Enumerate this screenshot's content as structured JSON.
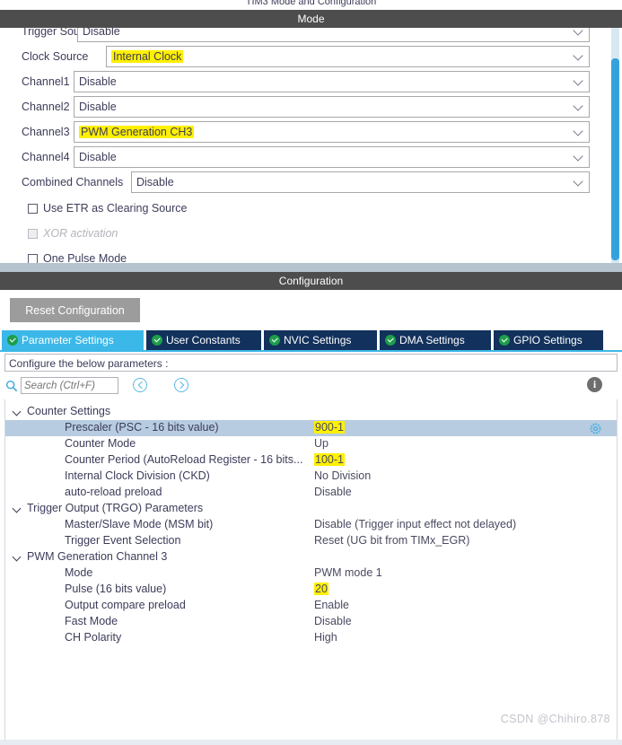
{
  "window": {
    "title": "TIM3 Mode and Configuration"
  },
  "sections": {
    "mode_header": "Mode",
    "configuration_header": "Configuration"
  },
  "mode": {
    "rows": [
      {
        "label": "Trigger Source",
        "value": "Disable",
        "highlighted": false
      },
      {
        "label": "Clock Source",
        "value": "Internal Clock",
        "highlighted": true
      },
      {
        "label": "Channel1",
        "value": "Disable",
        "highlighted": false
      },
      {
        "label": "Channel2",
        "value": "Disable",
        "highlighted": false
      },
      {
        "label": "Channel3",
        "value": "PWM Generation CH3",
        "highlighted": true
      },
      {
        "label": "Channel4",
        "value": "Disable",
        "highlighted": false
      },
      {
        "label": "Combined Channels",
        "value": "Disable",
        "highlighted": false
      }
    ],
    "checkboxes": [
      {
        "label": "Use ETR as Clearing Source",
        "checked": false,
        "disabled": false
      },
      {
        "label": "XOR activation",
        "checked": false,
        "disabled": true
      },
      {
        "label": "One Pulse Mode",
        "checked": false,
        "disabled": false
      }
    ]
  },
  "configuration": {
    "reset_button": "Reset Configuration",
    "tabs": [
      {
        "label": "Parameter Settings",
        "active": true
      },
      {
        "label": "User Constants",
        "active": false
      },
      {
        "label": "NVIC Settings",
        "active": false
      },
      {
        "label": "DMA Settings",
        "active": false
      },
      {
        "label": "GPIO Settings",
        "active": false
      }
    ],
    "hint": "Configure the below parameters :",
    "search_placeholder": "Search (Ctrl+F)",
    "search_value": "",
    "info_glyph": "i",
    "tree": [
      {
        "group": "Counter Settings",
        "expanded": true,
        "params": [
          {
            "name": "Prescaler (PSC - 16 bits value)",
            "value": "900-1",
            "highlighted": true,
            "selected": true,
            "gear": true
          },
          {
            "name": "Counter Mode",
            "value": "Up",
            "highlighted": false,
            "selected": false,
            "gear": false
          },
          {
            "name": "Counter Period (AutoReload Register - 16 bits...",
            "value": "100-1",
            "highlighted": true,
            "selected": false,
            "gear": false
          },
          {
            "name": "Internal Clock Division (CKD)",
            "value": "No Division",
            "highlighted": false,
            "selected": false,
            "gear": false
          },
          {
            "name": "auto-reload preload",
            "value": "Disable",
            "highlighted": false,
            "selected": false,
            "gear": false
          }
        ]
      },
      {
        "group": "Trigger Output (TRGO) Parameters",
        "expanded": true,
        "params": [
          {
            "name": "Master/Slave Mode (MSM bit)",
            "value": "Disable (Trigger input effect not delayed)",
            "highlighted": false,
            "selected": false,
            "gear": false
          },
          {
            "name": "Trigger Event Selection",
            "value": "Reset (UG bit from TIMx_EGR)",
            "highlighted": false,
            "selected": false,
            "gear": false
          }
        ]
      },
      {
        "group": "PWM Generation Channel 3",
        "expanded": true,
        "params": [
          {
            "name": "Mode",
            "value": "PWM mode 1",
            "highlighted": false,
            "selected": false,
            "gear": false
          },
          {
            "name": "Pulse (16 bits value)",
            "value": "20",
            "highlighted": true,
            "selected": false,
            "gear": false
          },
          {
            "name": "Output compare preload",
            "value": "Enable",
            "highlighted": false,
            "selected": false,
            "gear": false
          },
          {
            "name": "Fast Mode",
            "value": "Disable",
            "highlighted": false,
            "selected": false,
            "gear": false
          },
          {
            "name": "CH Polarity",
            "value": "High",
            "highlighted": false,
            "selected": false,
            "gear": false
          }
        ]
      }
    ]
  },
  "watermark": "CSDN @Chihiro.878",
  "colors": {
    "section_header_bg": "#4d4d4d",
    "active_tab": "#3cb8e8",
    "inactive_tab": "#12315c",
    "highlight": "#fff000",
    "selected_row": "#b7cce0",
    "scrollbar": "#34a3dc",
    "text": "#3c3c5a"
  }
}
